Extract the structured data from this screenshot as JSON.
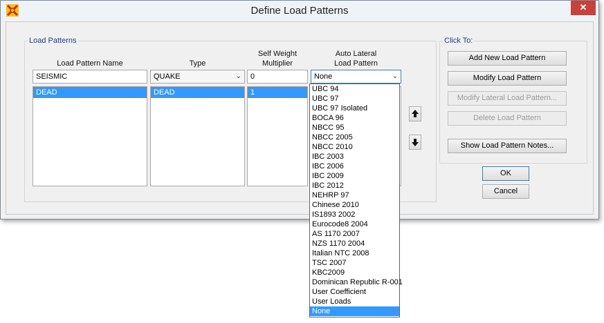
{
  "window": {
    "title": "Define Load Patterns",
    "close_glyph": "✕"
  },
  "load_patterns": {
    "group_label": "Load Patterns",
    "headers": {
      "name": "Load Pattern Name",
      "type": "Type",
      "self_weight": [
        "Self Weight",
        "Multiplier"
      ],
      "auto_lateral": [
        "Auto Lateral",
        "Load Pattern"
      ]
    },
    "inputs": {
      "name": "SEISMIC",
      "type": "QUAKE",
      "self_weight": "0",
      "auto_lateral": "None"
    },
    "rows": [
      {
        "name": "DEAD",
        "type": "DEAD",
        "self_weight": "1",
        "auto_lateral": ""
      }
    ]
  },
  "auto_lateral_options": [
    "UBC 94",
    "UBC 97",
    "UBC 97 Isolated",
    "BOCA 96",
    "NBCC 95",
    "NBCC 2005",
    "NBCC 2010",
    "IBC 2003",
    "IBC 2006",
    "IBC 2009",
    "IBC 2012",
    "NEHRP 97",
    "Chinese 2010",
    "IS1893 2002",
    "Eurocode8 2004",
    "AS 1170 2007",
    "NZS 1170 2004",
    "Italian NTC 2008",
    "TSC 2007",
    "KBC2009",
    "Dominican Republic R-001",
    "User Coefficient",
    "User Loads",
    "None"
  ],
  "auto_lateral_selected": "None",
  "click_to": {
    "group_label": "Click To:",
    "add": "Add New Load Pattern",
    "modify": "Modify Load Pattern",
    "modify_lateral": "Modify Lateral Load Pattern...",
    "delete": "Delete Load Pattern",
    "notes": "Show Load Pattern Notes..."
  },
  "buttons": {
    "ok": "OK",
    "cancel": "Cancel"
  },
  "icons": {
    "app": "app-logo-icon",
    "move_up": "arrow-up-icon",
    "move_down": "arrow-down-icon"
  }
}
